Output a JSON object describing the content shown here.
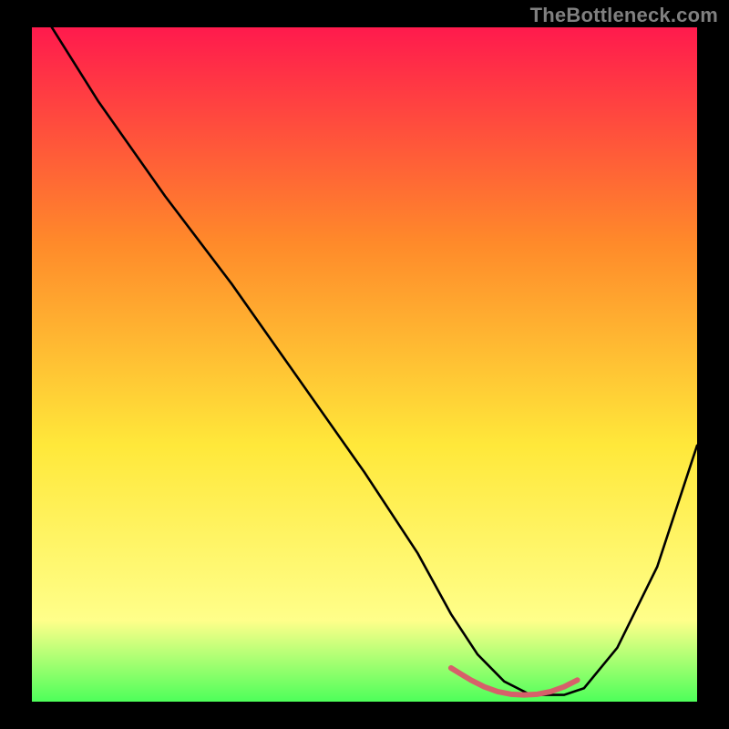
{
  "watermark": "TheBottleneck.com",
  "chart_data": {
    "type": "line",
    "title": "",
    "xlabel": "",
    "ylabel": "",
    "xlim": [
      0,
      100
    ],
    "ylim": [
      0,
      100
    ],
    "background_gradient": {
      "top": "#ff1a4d",
      "mid1": "#ff8a2a",
      "mid2": "#ffe83a",
      "low": "#ffff8a",
      "bottom": "#4dff5a"
    },
    "series": [
      {
        "name": "bottleneck-curve",
        "stroke": "#000000",
        "x": [
          3,
          10,
          20,
          30,
          40,
          50,
          58,
          63,
          67,
          71,
          75,
          80,
          83,
          88,
          94,
          100
        ],
        "values": [
          100,
          89,
          75,
          62,
          48,
          34,
          22,
          13,
          7,
          3,
          1,
          1,
          2,
          8,
          20,
          38
        ]
      },
      {
        "name": "valley-marker",
        "stroke": "#d6606a",
        "stroke_width": 6,
        "x": [
          63,
          66,
          68,
          70,
          72,
          74,
          76,
          78,
          80,
          82
        ],
        "values": [
          5,
          3.2,
          2.2,
          1.5,
          1.1,
          1.0,
          1.1,
          1.5,
          2.2,
          3.2
        ]
      }
    ]
  }
}
